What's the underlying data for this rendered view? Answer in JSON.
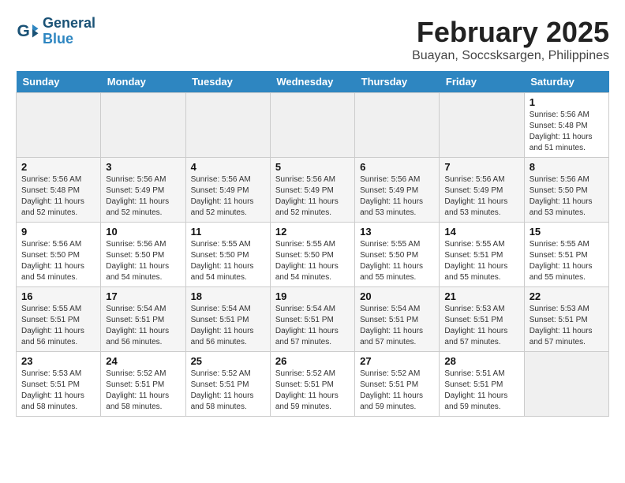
{
  "header": {
    "logo_line1": "General",
    "logo_line2": "Blue",
    "title": "February 2025",
    "subtitle": "Buayan, Soccsksargen, Philippines"
  },
  "days_of_week": [
    "Sunday",
    "Monday",
    "Tuesday",
    "Wednesday",
    "Thursday",
    "Friday",
    "Saturday"
  ],
  "weeks": [
    [
      {
        "day": "",
        "info": ""
      },
      {
        "day": "",
        "info": ""
      },
      {
        "day": "",
        "info": ""
      },
      {
        "day": "",
        "info": ""
      },
      {
        "day": "",
        "info": ""
      },
      {
        "day": "",
        "info": ""
      },
      {
        "day": "1",
        "info": "Sunrise: 5:56 AM\nSunset: 5:48 PM\nDaylight: 11 hours\nand 51 minutes."
      }
    ],
    [
      {
        "day": "2",
        "info": "Sunrise: 5:56 AM\nSunset: 5:48 PM\nDaylight: 11 hours\nand 52 minutes."
      },
      {
        "day": "3",
        "info": "Sunrise: 5:56 AM\nSunset: 5:49 PM\nDaylight: 11 hours\nand 52 minutes."
      },
      {
        "day": "4",
        "info": "Sunrise: 5:56 AM\nSunset: 5:49 PM\nDaylight: 11 hours\nand 52 minutes."
      },
      {
        "day": "5",
        "info": "Sunrise: 5:56 AM\nSunset: 5:49 PM\nDaylight: 11 hours\nand 52 minutes."
      },
      {
        "day": "6",
        "info": "Sunrise: 5:56 AM\nSunset: 5:49 PM\nDaylight: 11 hours\nand 53 minutes."
      },
      {
        "day": "7",
        "info": "Sunrise: 5:56 AM\nSunset: 5:49 PM\nDaylight: 11 hours\nand 53 minutes."
      },
      {
        "day": "8",
        "info": "Sunrise: 5:56 AM\nSunset: 5:50 PM\nDaylight: 11 hours\nand 53 minutes."
      }
    ],
    [
      {
        "day": "9",
        "info": "Sunrise: 5:56 AM\nSunset: 5:50 PM\nDaylight: 11 hours\nand 54 minutes."
      },
      {
        "day": "10",
        "info": "Sunrise: 5:56 AM\nSunset: 5:50 PM\nDaylight: 11 hours\nand 54 minutes."
      },
      {
        "day": "11",
        "info": "Sunrise: 5:55 AM\nSunset: 5:50 PM\nDaylight: 11 hours\nand 54 minutes."
      },
      {
        "day": "12",
        "info": "Sunrise: 5:55 AM\nSunset: 5:50 PM\nDaylight: 11 hours\nand 54 minutes."
      },
      {
        "day": "13",
        "info": "Sunrise: 5:55 AM\nSunset: 5:50 PM\nDaylight: 11 hours\nand 55 minutes."
      },
      {
        "day": "14",
        "info": "Sunrise: 5:55 AM\nSunset: 5:51 PM\nDaylight: 11 hours\nand 55 minutes."
      },
      {
        "day": "15",
        "info": "Sunrise: 5:55 AM\nSunset: 5:51 PM\nDaylight: 11 hours\nand 55 minutes."
      }
    ],
    [
      {
        "day": "16",
        "info": "Sunrise: 5:55 AM\nSunset: 5:51 PM\nDaylight: 11 hours\nand 56 minutes."
      },
      {
        "day": "17",
        "info": "Sunrise: 5:54 AM\nSunset: 5:51 PM\nDaylight: 11 hours\nand 56 minutes."
      },
      {
        "day": "18",
        "info": "Sunrise: 5:54 AM\nSunset: 5:51 PM\nDaylight: 11 hours\nand 56 minutes."
      },
      {
        "day": "19",
        "info": "Sunrise: 5:54 AM\nSunset: 5:51 PM\nDaylight: 11 hours\nand 57 minutes."
      },
      {
        "day": "20",
        "info": "Sunrise: 5:54 AM\nSunset: 5:51 PM\nDaylight: 11 hours\nand 57 minutes."
      },
      {
        "day": "21",
        "info": "Sunrise: 5:53 AM\nSunset: 5:51 PM\nDaylight: 11 hours\nand 57 minutes."
      },
      {
        "day": "22",
        "info": "Sunrise: 5:53 AM\nSunset: 5:51 PM\nDaylight: 11 hours\nand 57 minutes."
      }
    ],
    [
      {
        "day": "23",
        "info": "Sunrise: 5:53 AM\nSunset: 5:51 PM\nDaylight: 11 hours\nand 58 minutes."
      },
      {
        "day": "24",
        "info": "Sunrise: 5:52 AM\nSunset: 5:51 PM\nDaylight: 11 hours\nand 58 minutes."
      },
      {
        "day": "25",
        "info": "Sunrise: 5:52 AM\nSunset: 5:51 PM\nDaylight: 11 hours\nand 58 minutes."
      },
      {
        "day": "26",
        "info": "Sunrise: 5:52 AM\nSunset: 5:51 PM\nDaylight: 11 hours\nand 59 minutes."
      },
      {
        "day": "27",
        "info": "Sunrise: 5:52 AM\nSunset: 5:51 PM\nDaylight: 11 hours\nand 59 minutes."
      },
      {
        "day": "28",
        "info": "Sunrise: 5:51 AM\nSunset: 5:51 PM\nDaylight: 11 hours\nand 59 minutes."
      },
      {
        "day": "",
        "info": ""
      }
    ]
  ]
}
